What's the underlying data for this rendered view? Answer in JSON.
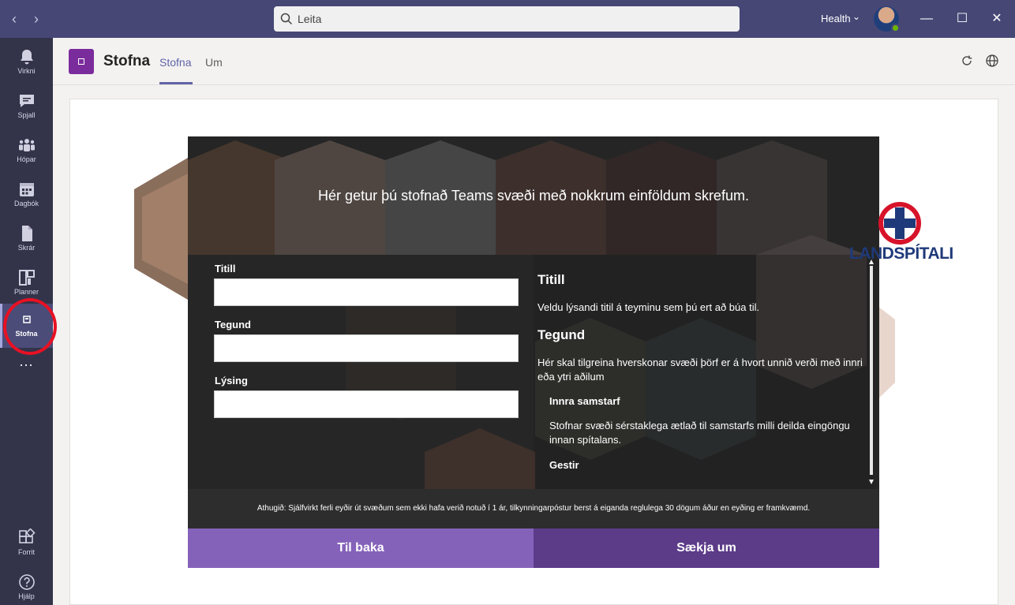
{
  "titlebar": {
    "search_placeholder": "Leita",
    "tenant": "Health"
  },
  "rail": {
    "items": [
      {
        "label": "Virkni",
        "icon": "bell-icon"
      },
      {
        "label": "Spjall",
        "icon": "chat-icon"
      },
      {
        "label": "Hópar",
        "icon": "teams-icon"
      },
      {
        "label": "Dagbók",
        "icon": "calendar-icon"
      },
      {
        "label": "Skrár",
        "icon": "files-icon"
      },
      {
        "label": "Planner",
        "icon": "planner-icon"
      },
      {
        "label": "Stofna",
        "icon": "app-icon",
        "active": true
      },
      {
        "label": "...",
        "icon": "more-icon"
      }
    ],
    "bottom": [
      {
        "label": "Forrit",
        "icon": "apps-icon"
      },
      {
        "label": "Hjálp",
        "icon": "help-icon"
      }
    ]
  },
  "app": {
    "title": "Stofna",
    "tabs": [
      {
        "label": "Stofna",
        "active": true
      },
      {
        "label": "Um",
        "active": false
      }
    ]
  },
  "panel": {
    "heading": "Hér getur þú stofnað Teams svæði með nokkrum einföldum skrefum.",
    "fields": [
      {
        "label": "Titill",
        "value": ""
      },
      {
        "label": "Tegund",
        "value": ""
      },
      {
        "label": "Lýsing",
        "value": ""
      }
    ],
    "help": {
      "h1": "Titill",
      "p1": "Veldu lýsandi titil á teyminu sem þú ert að búa til.",
      "h2": "Tegund",
      "p2": "Hér skal tilgreina hverskonar svæði þörf er á hvort unnið verði með innri eða ytri aðilum",
      "sub1": "Innra samstarf",
      "sub1_text": "Stofnar svæði sérstaklega ætlað til samstarfs milli deilda eingöngu innan spítalans.",
      "sub2": "Gestir"
    },
    "notice": "Athugið: Sjálfvirkt ferli eyðir út svæðum sem ekki hafa verið notuð í 1 ár, tilkynningarpóstur berst á eiganda reglulega 30 dögum áður en eyðing er framkvæmd.",
    "back_label": "Til baka",
    "apply_label": "Sækja um"
  },
  "logo": {
    "text": "LANDSPÍTALI",
    "colors": {
      "blue": "#1f3a7a",
      "red": "#d7132a"
    }
  },
  "colors": {
    "titlebar": "#464775",
    "rail": "#33344a",
    "accent": "#6264a7",
    "app_tile": "#7b2c9c",
    "back_button": "#8562ba",
    "apply_button": "#5c3b89"
  }
}
